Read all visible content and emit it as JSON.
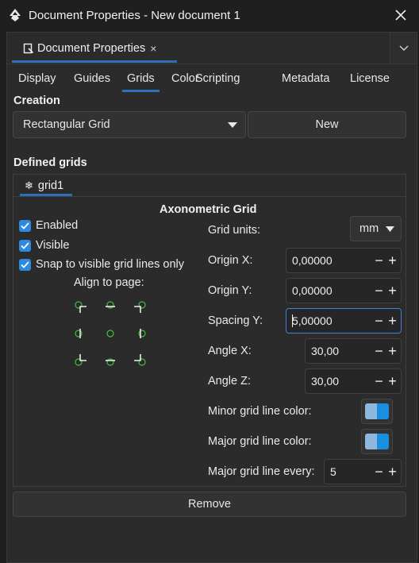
{
  "window": {
    "title": "Document Properties - New document 1"
  },
  "dock": {
    "tab_label": "Document Properties",
    "tab_close": "×"
  },
  "tabs": [
    "Display",
    "Guides",
    "Grids",
    "Color",
    "Scripting",
    "Metadata",
    "License"
  ],
  "active_tab": "Grids",
  "creation": {
    "label": "Creation",
    "grid_type": "Rectangular Grid",
    "new_button": "New"
  },
  "defined_grids": {
    "label": "Defined grids",
    "grid_tab": "grid1",
    "heading": "Axonometric Grid",
    "checks": [
      {
        "label": "Enabled",
        "checked": true
      },
      {
        "label": "Visible",
        "checked": true
      },
      {
        "label": "Snap to visible grid lines only",
        "checked": true
      }
    ],
    "align_label": "Align to page:",
    "fields": {
      "units_label": "Grid units:",
      "units_value": "mm",
      "origin_x_label": "Origin X:",
      "origin_x": "0,00000",
      "origin_y_label": "Origin Y:",
      "origin_y": "0,00000",
      "spacing_y_label": "Spacing Y:",
      "spacing_y": "5,00000",
      "angle_x_label": "Angle X:",
      "angle_x": "30,00",
      "angle_z_label": "Angle Z:",
      "angle_z": "30,00",
      "minor_color_label": "Minor grid line color:",
      "major_color_label": "Major grid line color:",
      "major_every_label": "Major grid line every:",
      "major_every": "5"
    },
    "remove_button": "Remove"
  },
  "colors": {
    "accent": "#2f6fb6",
    "checkbox": "#2d8ae0",
    "swatch_light": "#8fb8df",
    "swatch_dark": "#1a8fe0",
    "align_dot": "#3fbf3f"
  }
}
